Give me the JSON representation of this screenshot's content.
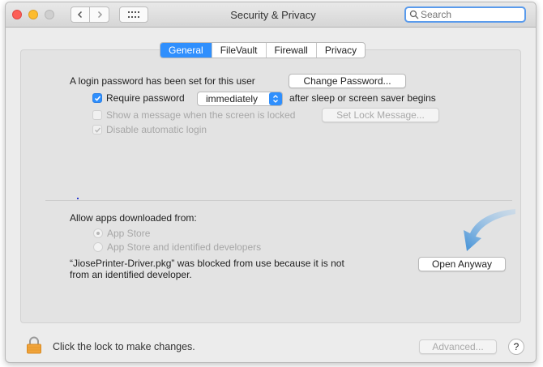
{
  "window": {
    "title": "Security & Privacy"
  },
  "toolbar": {
    "search_placeholder": "Search",
    "back_icon": "chevron-left-icon",
    "forward_icon": "chevron-right-icon",
    "grid_icon": "grid-icon"
  },
  "tabs": [
    {
      "label": "General",
      "active": true
    },
    {
      "label": "FileVault",
      "active": false
    },
    {
      "label": "Firewall",
      "active": false
    },
    {
      "label": "Privacy",
      "active": false
    }
  ],
  "general": {
    "login_password_text": "A login password has been set for this user",
    "change_password_button": "Change Password...",
    "require_password": {
      "label": "Require password",
      "checked": true,
      "select_value": "immediately",
      "suffix": "after sleep or screen saver begins"
    },
    "show_message": {
      "label": "Show a message when the screen is locked",
      "checked": false,
      "enabled": false,
      "button": "Set Lock Message..."
    },
    "disable_autologin": {
      "label": "Disable automatic login",
      "checked": true,
      "enabled": false
    }
  },
  "apps": {
    "heading": "Allow apps downloaded from:",
    "options": [
      {
        "label": "App Store",
        "selected": true
      },
      {
        "label": "App Store and identified developers",
        "selected": false
      }
    ],
    "blocked_message_line1": "“JiosePrinter-Driver.pkg” was blocked from use because it is not",
    "blocked_message_line2": "from an identified developer.",
    "open_anyway_button": "Open Anyway"
  },
  "footer": {
    "lock_text": "Click the lock to make changes.",
    "advanced_button": "Advanced...",
    "help_label": "?"
  },
  "colors": {
    "accent": "#2f8ffd",
    "arrow": "#4a97d8"
  }
}
